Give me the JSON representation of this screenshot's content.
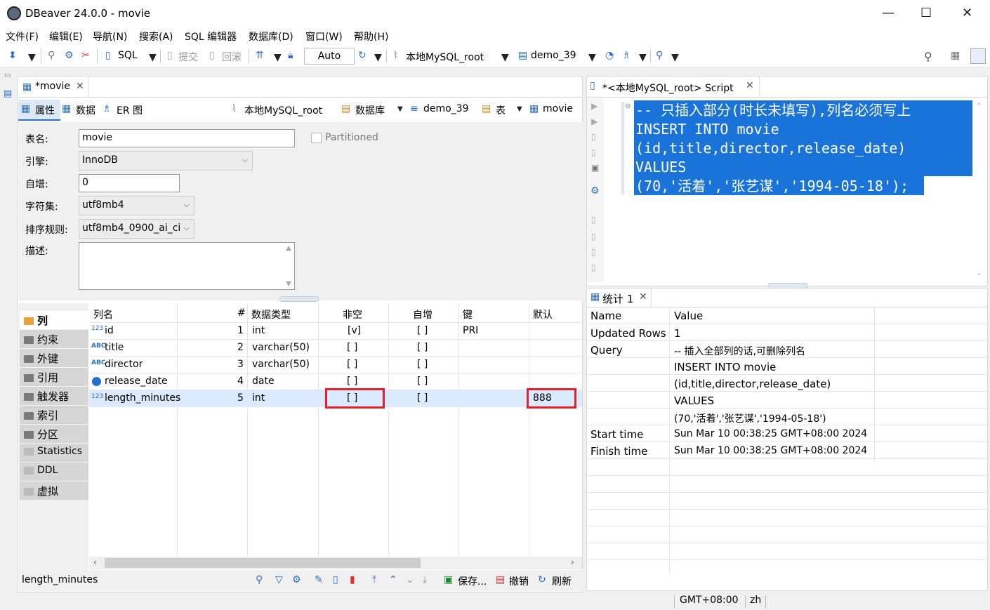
{
  "window": {
    "title": "DBeaver 24.0.0 - movie",
    "minimize": "—",
    "maximize": "☐",
    "close": "✕"
  },
  "menu": [
    "文件(F)",
    "编辑(E)",
    "导航(N)",
    "搜索(A)",
    "SQL 编辑器",
    "数据库(D)",
    "窗口(W)",
    "帮助(H)"
  ],
  "toolbar": {
    "sql": "SQL",
    "commit": "提交",
    "rollback": "回滚",
    "auto": "Auto",
    "connection": "本地MySQL_root",
    "database": "demo_39"
  },
  "left_editor": {
    "tab_title": "*movie",
    "subtabs": [
      "属性",
      "数据",
      "ER 图"
    ],
    "breadcrumb": {
      "connection": "本地MySQL_root",
      "databases": "数据库",
      "schema": "demo_39",
      "tables": "表",
      "table": "movie"
    },
    "props": {
      "name_label": "表名:",
      "name_value": "movie",
      "partitioned": "Partitioned",
      "engine_label": "引擎:",
      "engine_value": "InnoDB",
      "autoinc_label": "自增:",
      "autoinc_value": "0",
      "charset_label": "字符集:",
      "charset_value": "utf8mb4",
      "collation_label": "排序规则:",
      "collation_value": "utf8mb4_0900_ai_ci",
      "desc_label": "描述:"
    },
    "nav": [
      "列",
      "约束",
      "外键",
      "引用",
      "触发器",
      "索引",
      "分区",
      "Statistics",
      "DDL",
      "虚拟"
    ],
    "columns_header": [
      "列名",
      "#",
      "数据类型",
      "非空",
      "自增",
      "键",
      "默认"
    ],
    "columns": [
      {
        "name": "id",
        "type_icon": "123",
        "num": "1",
        "dtype": "int",
        "notnull": "[v]",
        "autoinc": "[ ]",
        "key": "PRI",
        "default": ""
      },
      {
        "name": "title",
        "type_icon": "ABC",
        "num": "2",
        "dtype": "varchar(50)",
        "notnull": "[ ]",
        "autoinc": "[ ]",
        "key": "",
        "default": ""
      },
      {
        "name": "director",
        "type_icon": "ABC",
        "num": "3",
        "dtype": "varchar(50)",
        "notnull": "[ ]",
        "autoinc": "[ ]",
        "key": "",
        "default": ""
      },
      {
        "name": "release_date",
        "type_icon": "clock",
        "num": "4",
        "dtype": "date",
        "notnull": "[ ]",
        "autoinc": "[ ]",
        "key": "",
        "default": ""
      },
      {
        "name": "length_minutes",
        "type_icon": "123",
        "num": "5",
        "dtype": "int",
        "notnull": "[ ]",
        "autoinc": "[ ]",
        "key": "",
        "default": "888"
      }
    ],
    "bottom": {
      "selected": "length_minutes",
      "save": "保存...",
      "undo": "撤销",
      "refresh": "刷新"
    }
  },
  "script": {
    "tab_title": "*<本地MySQL_root> Script",
    "lines": [
      "-- 只插入部分(时长未填写),列名必须写上",
      "INSERT INTO movie",
      "(id,title,director,release_date)",
      "VALUES",
      "(70,'活着','张艺谋','1994-05-18');"
    ]
  },
  "stats": {
    "tab_title": "统计 1",
    "header": [
      "Name",
      "Value"
    ],
    "rows": [
      [
        "Updated Rows",
        "1"
      ],
      [
        "Query",
        "-- 插入全部列的话,可删除列名"
      ],
      [
        "",
        "INSERT INTO movie"
      ],
      [
        "",
        "(id,title,director,release_date)"
      ],
      [
        "",
        "VALUES"
      ],
      [
        "",
        "(70,'活着','张艺谋','1994-05-18')"
      ],
      [
        "Start time",
        "Sun Mar 10 00:38:25 GMT+08:00 2024"
      ],
      [
        "Finish time",
        "Sun Mar 10 00:38:25 GMT+08:00 2024"
      ]
    ]
  },
  "status": {
    "timezone": "GMT+08:00",
    "locale": "zh"
  },
  "colors": {
    "selection": "#1a73d9",
    "highlight": "#e5202a",
    "row_selected": "#dbeafe"
  }
}
